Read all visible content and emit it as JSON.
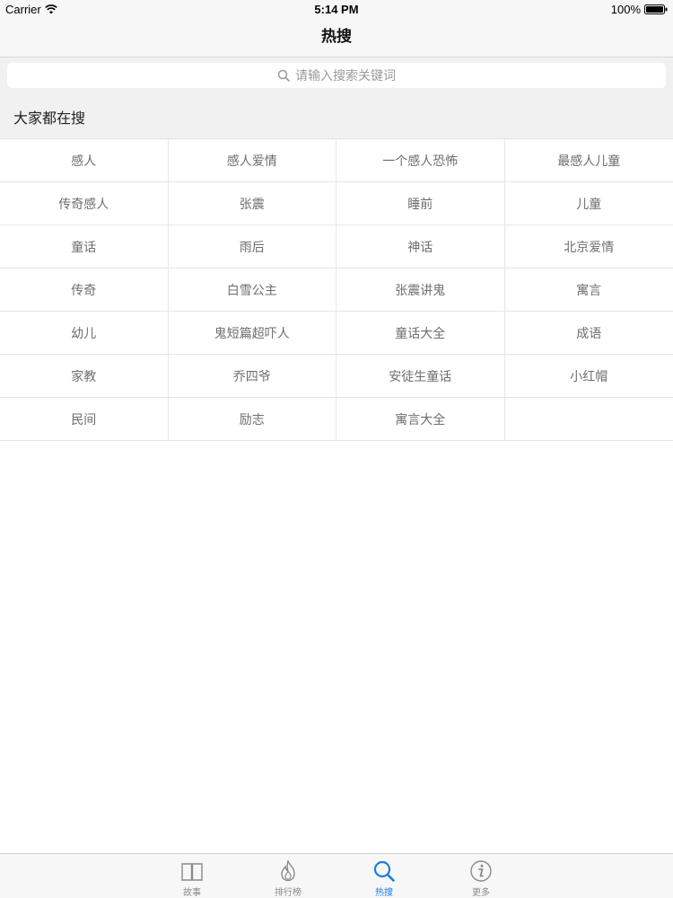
{
  "status_bar": {
    "carrier": "Carrier",
    "time": "5:14 PM",
    "battery": "100%"
  },
  "nav": {
    "title": "热搜"
  },
  "search": {
    "placeholder": "请输入搜索关键词",
    "icon": "search-icon"
  },
  "section": {
    "title": "大家都在搜"
  },
  "hot_terms": [
    "感人",
    "感人爱情",
    "一个感人恐怖",
    "最感人儿童",
    "传奇感人",
    "张震",
    "睡前",
    "儿童",
    "童话",
    "雨后",
    "神话",
    "北京爱情",
    "传奇",
    "白雪公主",
    "张震讲鬼",
    "寓言",
    "幼儿",
    "鬼短篇超吓人",
    "童话大全",
    "成语",
    "家教",
    "乔四爷",
    "安徒生童话",
    "小红帽",
    "民间",
    "励志",
    "寓言大全"
  ],
  "tabs": [
    {
      "label": "故事",
      "icon": "book-icon",
      "active": false
    },
    {
      "label": "排行榜",
      "icon": "flame-icon",
      "active": false
    },
    {
      "label": "热搜",
      "icon": "search-icon",
      "active": true
    },
    {
      "label": "更多",
      "icon": "info-icon",
      "active": false
    }
  ],
  "colors": {
    "accent": "#1a7fe0",
    "inactive": "#8a8a8a",
    "term_text": "#6e6e6e"
  }
}
